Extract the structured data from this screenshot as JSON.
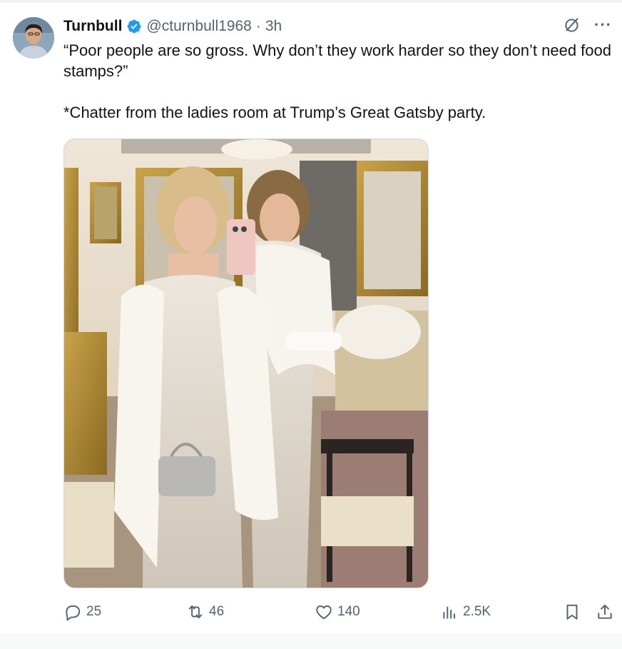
{
  "tweet": {
    "author_name": "Turnbull",
    "handle": "@cturnbull1968",
    "separator": "·",
    "time": "3h",
    "text_line1": "“Poor people are so gross. Why don’t they work harder so they don’t need food stamps?”",
    "text_line2": "*Chatter from the ladies room at Trump’s Great Gatsby party."
  },
  "metrics": {
    "replies": "25",
    "reposts": "46",
    "likes": "140",
    "views": "2.5K"
  },
  "icons": {
    "verified": "verified-badge-icon",
    "grok": "grok-icon",
    "more": "more-icon",
    "reply": "reply-icon",
    "repost": "repost-icon",
    "like": "like-icon",
    "views": "views-icon",
    "bookmark": "bookmark-icon",
    "share": "share-icon"
  },
  "colors": {
    "verified": "#1d9bf0",
    "text_primary": "#0f1419",
    "text_secondary": "#536471",
    "border": "#cfd9de"
  }
}
